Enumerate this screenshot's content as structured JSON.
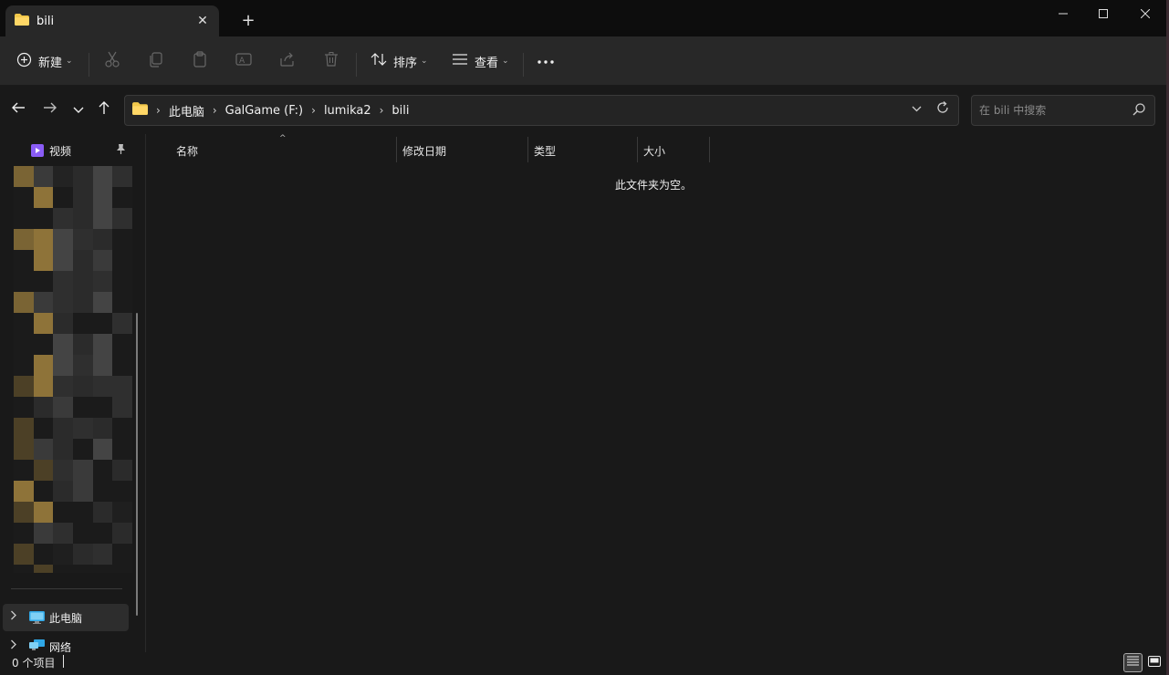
{
  "tab": {
    "title": "bili",
    "close": "✕",
    "new": "+"
  },
  "window_controls": {
    "minimize": "—",
    "maximize": "☐",
    "close": "✕"
  },
  "toolbar": {
    "new_label": "新建",
    "sort_label": "排序",
    "view_label": "查看",
    "more": "···"
  },
  "address": {
    "crumbs": [
      "此电脑",
      "GalGame (F:)",
      "lumika2",
      "bili"
    ]
  },
  "search": {
    "placeholder": "在 bili 中搜索"
  },
  "nav": {
    "videos_label": "视频",
    "this_pc_label": "此电脑",
    "network_label": "网络"
  },
  "columns": {
    "name": "名称",
    "modified": "修改日期",
    "type": "类型",
    "size": "大小"
  },
  "empty_message": "此文件夹为空。",
  "status": {
    "item_count": "0 个项目"
  },
  "colors": {
    "folder": "#f2c84b",
    "accent_video": "#8a5cf6",
    "bg": "#191919",
    "bar": "#282828"
  },
  "icons": [
    "folder-icon",
    "close-icon",
    "plus-icon",
    "new-icon",
    "cut-icon",
    "copy-icon",
    "paste-icon",
    "rename-icon",
    "share-icon",
    "delete-icon",
    "sort-icon",
    "view-icon",
    "more-icon",
    "back-icon",
    "forward-icon",
    "recent-icon",
    "up-icon",
    "refresh-icon",
    "search-icon",
    "video-icon",
    "pin-icon",
    "pc-icon",
    "network-icon",
    "details-view-icon",
    "tiles-view-icon"
  ]
}
